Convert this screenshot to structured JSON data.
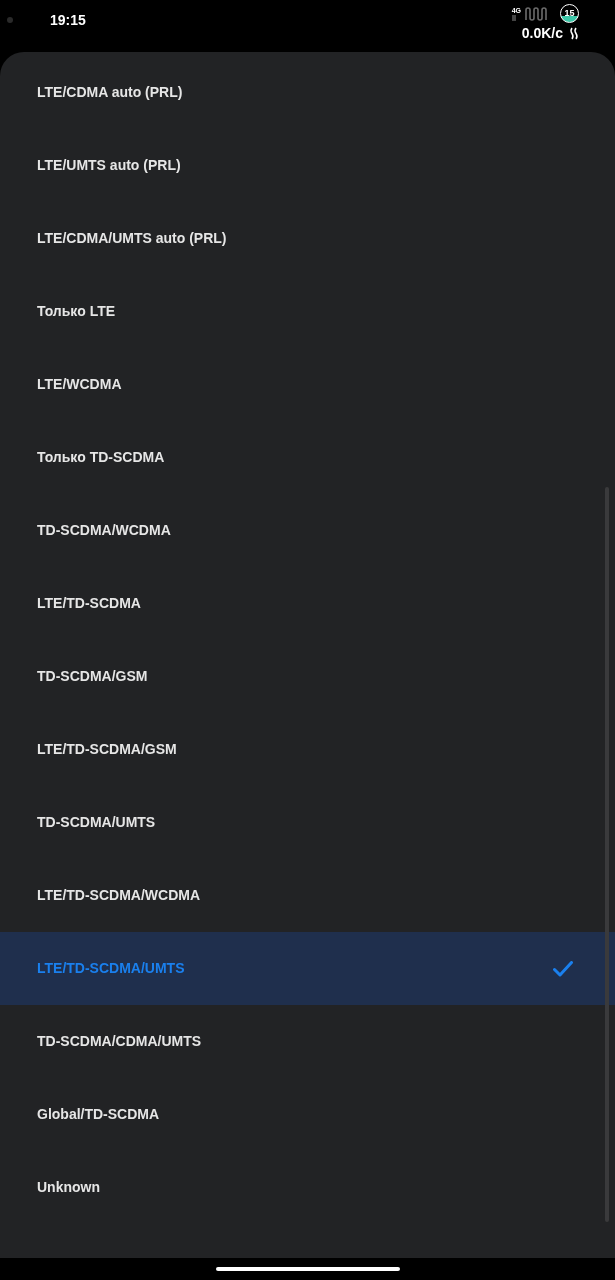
{
  "status_bar": {
    "time": "19:15",
    "network_type": "4G",
    "battery": "15",
    "net_speed": "0.0K/c"
  },
  "options": [
    {
      "label": "LTE/CDMA auto (PRL)",
      "selected": false
    },
    {
      "label": "LTE/UMTS auto (PRL)",
      "selected": false
    },
    {
      "label": "LTE/CDMA/UMTS auto (PRL)",
      "selected": false
    },
    {
      "label": "Только LTE",
      "selected": false
    },
    {
      "label": "LTE/WCDMA",
      "selected": false
    },
    {
      "label": "Только TD-SCDMA",
      "selected": false
    },
    {
      "label": "TD-SCDMA/WCDMA",
      "selected": false
    },
    {
      "label": "LTE/TD-SCDMA",
      "selected": false
    },
    {
      "label": "TD-SCDMA/GSM",
      "selected": false
    },
    {
      "label": "LTE/TD-SCDMA/GSM",
      "selected": false
    },
    {
      "label": "TD-SCDMA/UMTS",
      "selected": false
    },
    {
      "label": "LTE/TD-SCDMA/WCDMA",
      "selected": false
    },
    {
      "label": "LTE/TD-SCDMA/UMTS",
      "selected": true
    },
    {
      "label": "TD-SCDMA/CDMA/UMTS",
      "selected": false
    },
    {
      "label": "Global/TD-SCDMA",
      "selected": false
    },
    {
      "label": "Unknown",
      "selected": false
    }
  ]
}
